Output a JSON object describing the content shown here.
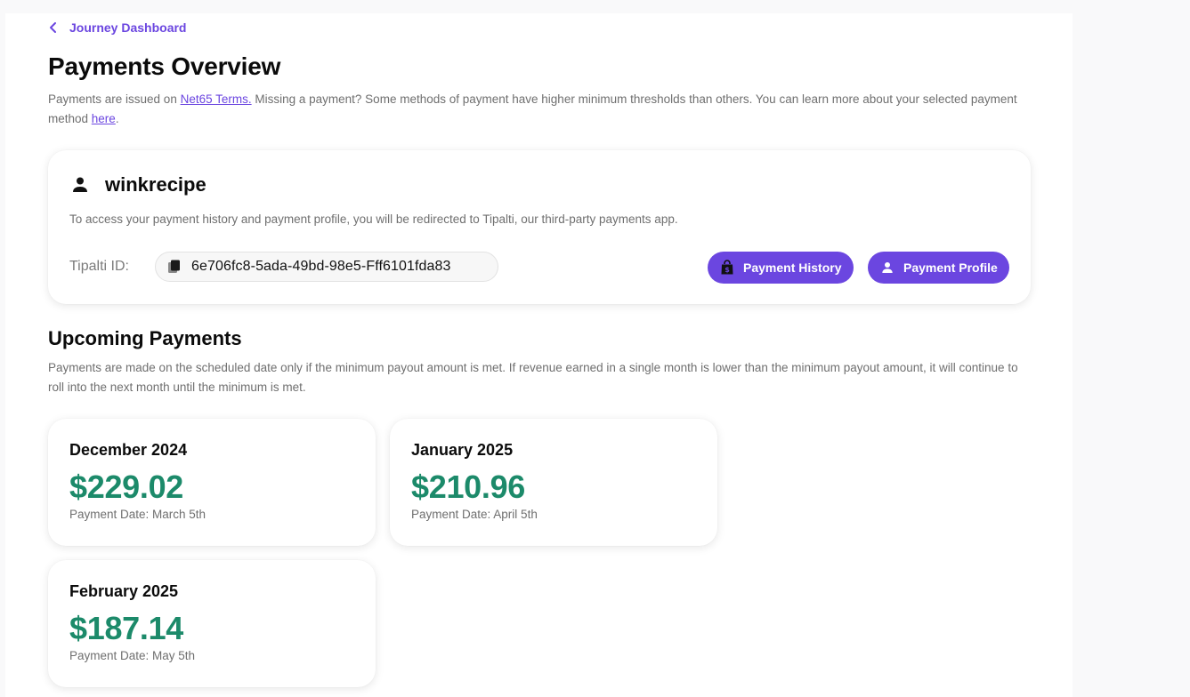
{
  "breadcrumb": {
    "label": "Journey Dashboard"
  },
  "page": {
    "title": "Payments Overview"
  },
  "intro": {
    "text_1": "Payments are issued on ",
    "net_terms_link": "Net65 Terms.",
    "text_2": " Missing a payment? Some methods of payment have higher minimum thresholds than others. You can learn more about your selected payment method ",
    "here_link": "here",
    "text_3": "."
  },
  "user": {
    "username": "winkrecipe",
    "redirect_note": "To access your payment history and payment profile, you will be redirected to Tipalti, our third-party payments app.",
    "tipalti_label": "Tipalti ID:",
    "tipalti_id": "6e706fc8-5ada-49bd-98e5-Fff6101fda83",
    "payment_history_label": "Payment History",
    "payment_profile_label": "Payment Profile"
  },
  "upcoming": {
    "title": "Upcoming Payments",
    "description": "Payments are made on the scheduled date only if the minimum payout amount is met. If revenue earned in a single month is lower than the minimum payout amount, it will continue to roll into the next month until the minimum is met.",
    "payments": [
      {
        "month": "December 2024",
        "amount": "$229.02",
        "date": "Payment Date: March 5th"
      },
      {
        "month": "January 2025",
        "amount": "$210.96",
        "date": "Payment Date: April 5th"
      },
      {
        "month": "February 2025",
        "amount": "$187.14",
        "date": "Payment Date: May 5th"
      }
    ]
  },
  "colors": {
    "accent": "#6b46e0",
    "amount": "#1c8a6a",
    "muted_text": "#6f6f6f"
  },
  "icons": {
    "back": "chevron-left-icon",
    "user": "person-icon",
    "copy": "copy-icon",
    "history": "shopping-bag-dollar-icon",
    "profile": "person-icon"
  }
}
